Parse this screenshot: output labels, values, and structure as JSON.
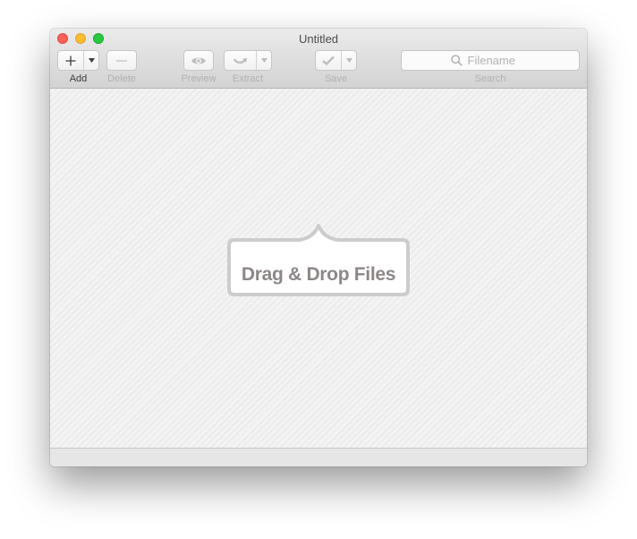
{
  "window": {
    "title": "Untitled",
    "traffic_lights": {
      "close_color": "#fc5f57",
      "minimize_color": "#fdbc2e",
      "maximize_color": "#28c940"
    }
  },
  "toolbar": {
    "add": {
      "label": "Add",
      "icon": "plus-icon",
      "menu_icon": "dropdown-arrow-icon"
    },
    "delete": {
      "label": "Delete",
      "icon": "minus-icon"
    },
    "preview": {
      "label": "Preview",
      "icon": "eye-icon"
    },
    "extract": {
      "label": "Extract",
      "icon": "extract-arrow-icon",
      "menu_icon": "dropdown-arrow-icon"
    },
    "save": {
      "label": "Save",
      "icon": "checkmark-icon",
      "menu_icon": "dropdown-arrow-icon"
    },
    "search": {
      "label": "Search",
      "placeholder": "Filename",
      "value": "",
      "icon": "search-icon"
    }
  },
  "main": {
    "drop_zone_text": "Drag & Drop Files"
  },
  "colors": {
    "drop_text": "#8d8787",
    "disabled_icon": "#b9b9b9",
    "active_icon": "#3a3a3a"
  }
}
